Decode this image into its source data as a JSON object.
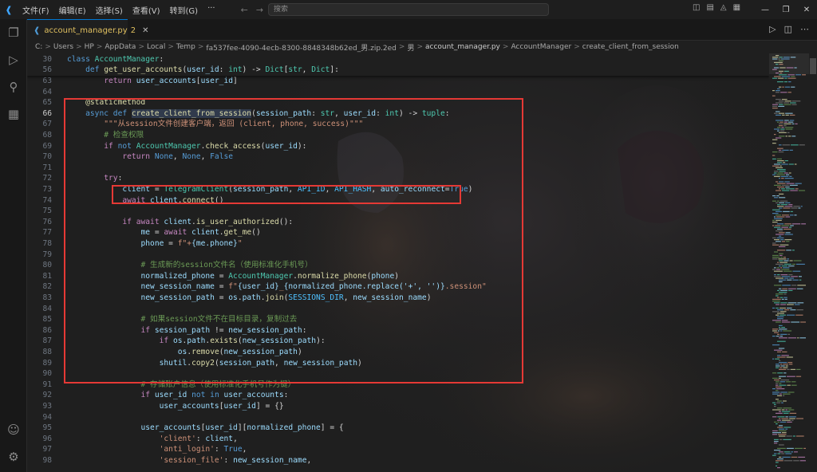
{
  "titlebar": {
    "menu": [
      "文件(F)",
      "编辑(E)",
      "选择(S)",
      "查看(V)",
      "转到(G)",
      "···"
    ],
    "search_placeholder": "搜索"
  },
  "tab": {
    "filename": "account_manager.py",
    "problems_count": "2"
  },
  "breadcrumb": [
    "C:",
    "Users",
    "HP",
    "AppData",
    "Local",
    "Temp",
    "fa537fee-4090-4ecb-8300-8848348b62ed_男.zip.2ed",
    "男",
    "account_manager.py",
    "AccountManager",
    "create_client_from_session"
  ],
  "sticky_lines": [
    {
      "n": "30",
      "code": "class AccountManager:"
    },
    {
      "n": "56",
      "code": "    def get_user_accounts(user_id: int) -> Dict[str, Dict]:"
    }
  ],
  "lines": [
    {
      "n": "63",
      "code": "        return user_accounts[user_id]"
    },
    {
      "n": "64",
      "code": ""
    },
    {
      "n": "65",
      "code": "    @staticmethod"
    },
    {
      "n": "66",
      "code": "    async def create_client_from_session(session_path: str, user_id: int) -> tuple:"
    },
    {
      "n": "67",
      "code": "        \"\"\"从session文件创建客户端，返回 (client, phone, success)\"\"\""
    },
    {
      "n": "68",
      "code": "        # 检查权限"
    },
    {
      "n": "69",
      "code": "        if not AccountManager.check_access(user_id):"
    },
    {
      "n": "70",
      "code": "            return None, None, False"
    },
    {
      "n": "71",
      "code": ""
    },
    {
      "n": "72",
      "code": "        try:"
    },
    {
      "n": "73",
      "code": "            client = TelegramClient(session_path, API_ID, API_HASH, auto_reconnect=True)"
    },
    {
      "n": "74",
      "code": "            await client.connect()"
    },
    {
      "n": "75",
      "code": ""
    },
    {
      "n": "76",
      "code": "            if await client.is_user_authorized():"
    },
    {
      "n": "77",
      "code": "                me = await client.get_me()"
    },
    {
      "n": "78",
      "code": "                phone = f\"+{me.phone}\""
    },
    {
      "n": "79",
      "code": ""
    },
    {
      "n": "80",
      "code": "                # 生成新的session文件名（使用标准化手机号）"
    },
    {
      "n": "81",
      "code": "                normalized_phone = AccountManager.normalize_phone(phone)"
    },
    {
      "n": "82",
      "code": "                new_session_name = f\"{user_id}_{normalized_phone.replace('+', '')}.session\""
    },
    {
      "n": "83",
      "code": "                new_session_path = os.path.join(SESSIONS_DIR, new_session_name)"
    },
    {
      "n": "84",
      "code": ""
    },
    {
      "n": "85",
      "code": "                # 如果session文件不在目标目录，复制过去"
    },
    {
      "n": "86",
      "code": "                if session_path != new_session_path:"
    },
    {
      "n": "87",
      "code": "                    if os.path.exists(new_session_path):"
    },
    {
      "n": "88",
      "code": "                        os.remove(new_session_path)"
    },
    {
      "n": "89",
      "code": "                    shutil.copy2(session_path, new_session_path)"
    },
    {
      "n": "90",
      "code": ""
    },
    {
      "n": "91",
      "code": "                # 存储账户信息（使用标准化手机号作为键）"
    },
    {
      "n": "92",
      "code": "                if user_id not in user_accounts:"
    },
    {
      "n": "93",
      "code": "                    user_accounts[user_id] = {}"
    },
    {
      "n": "94",
      "code": ""
    },
    {
      "n": "95",
      "code": "                user_accounts[user_id][normalized_phone] = {"
    },
    {
      "n": "96",
      "code": "                    'client': client,"
    },
    {
      "n": "97",
      "code": "                    'anti_login': True,"
    },
    {
      "n": "98",
      "code": "                    'session_file': new_session_name,"
    }
  ],
  "current_line": "66",
  "highlighted_symbol": "create_client_from_session",
  "colors": {
    "accent": "#0078d4",
    "annotation_red": "#e53935"
  }
}
